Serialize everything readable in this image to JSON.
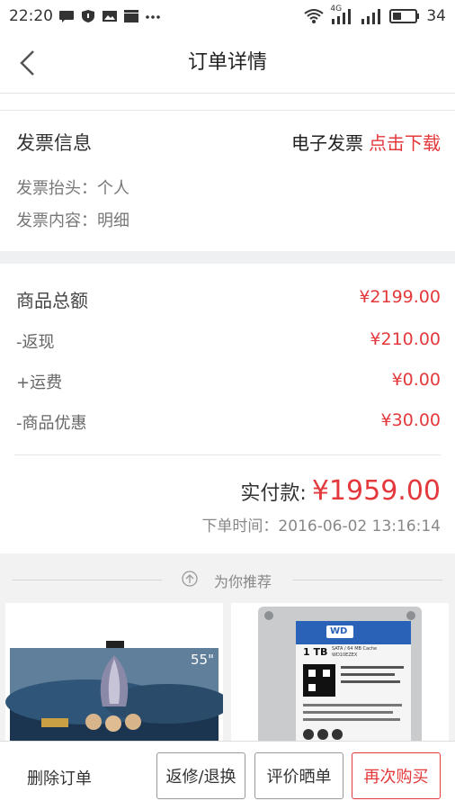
{
  "status_bar": {
    "time": "22:20",
    "network": "4G",
    "battery": "34"
  },
  "nav": {
    "title": "订单详情"
  },
  "invoice": {
    "title": "发票信息",
    "type": "电子发票",
    "download": "点击下载",
    "header_label": "发票抬头：个人",
    "content_label": "发票内容：明细"
  },
  "amounts": {
    "rows": [
      {
        "label": "商品总额",
        "value": "¥2199.00"
      },
      {
        "label": "-返现",
        "value": "¥210.00"
      },
      {
        "label": "+运费",
        "value": "¥0.00"
      },
      {
        "label": "-商品优惠",
        "value": "¥30.00"
      }
    ],
    "paid_label": "实付款:",
    "paid_value": "¥1959.00",
    "order_time": "下单时间：2016-06-02 13:16:14"
  },
  "recommend": {
    "title": "为你推荐",
    "items": [
      {
        "name": "tv",
        "badge": "55\""
      },
      {
        "name": "hard-drive",
        "capacity": "1 TB",
        "brand": "WD",
        "spec": "SATA / 64 MB Cache",
        "model": "WD10EZEX"
      }
    ]
  },
  "actions": {
    "delete": "删除订单",
    "repair": "返修/退换",
    "review": "评价晒单",
    "rebuy": "再次购买"
  },
  "colors": {
    "accent": "#e4393c",
    "gray_bar": "#eef0f2"
  }
}
